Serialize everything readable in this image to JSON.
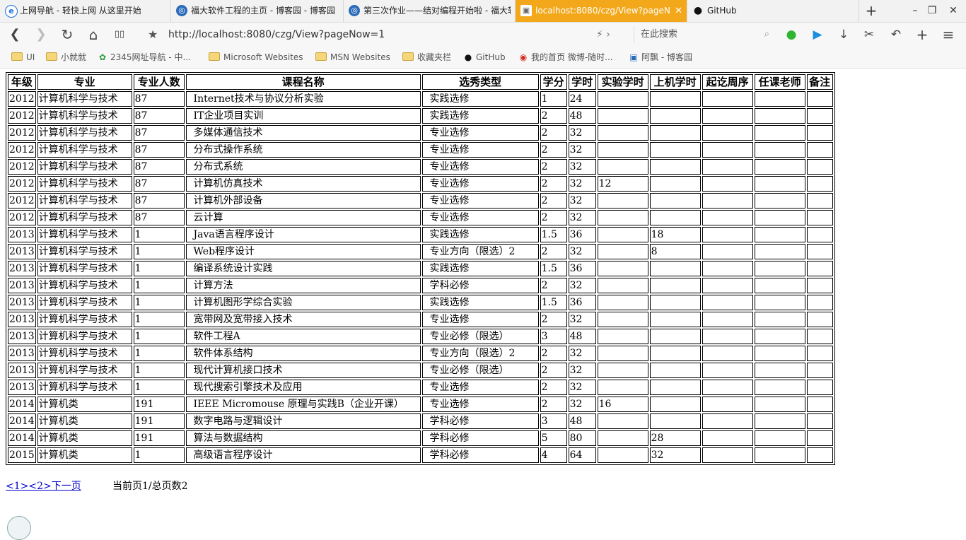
{
  "tabs": [
    {
      "label": "上网导航 - 轻快上网 从这里开始",
      "icon": "e"
    },
    {
      "label": "福大软件工程的主页 - 博客园 - 博客园",
      "icon": "◎"
    },
    {
      "label": "第三次作业——结对编程开始啦 - 福大软件工程",
      "icon": "◎"
    },
    {
      "label": "localhost:8080/czg/View?pageN",
      "icon": "▣",
      "close": "✕"
    },
    {
      "label": "GitHub",
      "icon": "●"
    }
  ],
  "window_controls": [
    "+",
    "–",
    "❐",
    "✕"
  ],
  "nav": {
    "back": "❮",
    "forward": "❯",
    "reload": "↻",
    "home": "⌂",
    "reader": "▯▯",
    "star": "★",
    "url": "http://localhost:8080/czg/View?pageNow=1",
    "lightning": "⚡ ›",
    "search_placeholder": "在此搜索",
    "search_icon": "⌕",
    "tools": [
      "●",
      "▶",
      "↓",
      "✂",
      "↶",
      "+",
      "≡"
    ]
  },
  "bookmarks": [
    {
      "label": "UI",
      "type": "folder"
    },
    {
      "label": "小就就",
      "type": "folder"
    },
    {
      "label": "2345网址导航 - 中...",
      "type": "site",
      "icon": "✿"
    },
    {
      "label": "Microsoft Websites",
      "type": "folder"
    },
    {
      "label": "MSN Websites",
      "type": "folder"
    },
    {
      "label": "收藏夹栏",
      "type": "folder"
    },
    {
      "label": "GitHub",
      "type": "site",
      "icon": "●"
    },
    {
      "label": "我的首页 微博-随时...",
      "type": "site",
      "icon": "◉"
    },
    {
      "label": "阿飘 - 博客园",
      "type": "site",
      "icon": "▣"
    }
  ],
  "table": {
    "headers": [
      "年级",
      "专业",
      "专业人数",
      "课程名称",
      "选秀类型",
      "学分",
      "学时",
      "实验学时",
      "上机学时",
      "起讫周序",
      "任课老师",
      "备注"
    ],
    "rows": [
      [
        "2012",
        "计算机科学与技术",
        "87",
        "  Internet技术与协议分析实验",
        "  实践选修",
        "1",
        "24",
        "",
        "",
        "",
        "",
        ""
      ],
      [
        "2012",
        "计算机科学与技术",
        "87",
        "  IT企业项目实训",
        "  实践选修",
        "2",
        "48",
        "",
        "",
        "",
        "",
        ""
      ],
      [
        "2012",
        "计算机科学与技术",
        "87",
        "  多媒体通信技术",
        "  专业选修",
        "2",
        "32",
        "",
        "",
        "",
        "",
        ""
      ],
      [
        "2012",
        "计算机科学与技术",
        "87",
        "  分布式操作系统",
        "  专业选修",
        "2",
        "32",
        "",
        "",
        "",
        "",
        ""
      ],
      [
        "2012",
        "计算机科学与技术",
        "87",
        "  分布式系统",
        "  专业选修",
        "2",
        "32",
        "",
        "",
        "",
        "",
        ""
      ],
      [
        "2012",
        "计算机科学与技术",
        "87",
        "  计算机仿真技术",
        "  专业选修",
        "2",
        "32",
        "12",
        "",
        "",
        "",
        ""
      ],
      [
        "2012",
        "计算机科学与技术",
        "87",
        "  计算机外部设备",
        "  专业选修",
        "2",
        "32",
        "",
        "",
        "",
        "",
        ""
      ],
      [
        "2012",
        "计算机科学与技术",
        "87",
        "  云计算",
        "  专业选修",
        "2",
        "32",
        "",
        "",
        "",
        "",
        ""
      ],
      [
        "2013",
        "计算机科学与技术",
        "1",
        "  Java语言程序设计",
        "  实践选修",
        "1.5",
        "36",
        "",
        "18",
        "",
        "",
        ""
      ],
      [
        "2013",
        "计算机科学与技术",
        "1",
        "  Web程序设计",
        "  专业方向（限选）2",
        "2",
        "32",
        "",
        "8",
        "",
        "",
        ""
      ],
      [
        "2013",
        "计算机科学与技术",
        "1",
        "  编译系统设计实践",
        "  实践选修",
        "1.5",
        "36",
        "",
        "",
        "",
        "",
        ""
      ],
      [
        "2013",
        "计算机科学与技术",
        "1",
        "  计算方法",
        "  学科必修",
        "2",
        "32",
        "",
        "",
        "",
        "",
        ""
      ],
      [
        "2013",
        "计算机科学与技术",
        "1",
        "  计算机图形学综合实验",
        "  实践选修",
        "1.5",
        "36",
        "",
        "",
        "",
        "",
        ""
      ],
      [
        "2013",
        "计算机科学与技术",
        "1",
        "  宽带网及宽带接入技术",
        "  专业选修",
        "2",
        "32",
        "",
        "",
        "",
        "",
        ""
      ],
      [
        "2013",
        "计算机科学与技术",
        "1",
        "  软件工程A",
        "  专业必修（限选）",
        "3",
        "48",
        "",
        "",
        "",
        "",
        ""
      ],
      [
        "2013",
        "计算机科学与技术",
        "1",
        "  软件体系结构",
        "  专业方向（限选）2",
        "2",
        "32",
        "",
        "",
        "",
        "",
        ""
      ],
      [
        "2013",
        "计算机科学与技术",
        "1",
        "  现代计算机接口技术",
        "  专业必修（限选）",
        "2",
        "32",
        "",
        "",
        "",
        "",
        ""
      ],
      [
        "2013",
        "计算机科学与技术",
        "1",
        "  现代搜索引擎技术及应用",
        "  专业选修",
        "2",
        "32",
        "",
        "",
        "",
        "",
        ""
      ],
      [
        "2014",
        "计算机类",
        "191",
        "  IEEE Micromouse 原理与实践B（企业开课）",
        "  专业选修",
        "2",
        "32",
        "16",
        "",
        "",
        "",
        ""
      ],
      [
        "2014",
        "计算机类",
        "191",
        "  数字电路与逻辑设计",
        "  学科必修",
        "3",
        "48",
        "",
        "",
        "",
        "",
        ""
      ],
      [
        "2014",
        "计算机类",
        "191",
        "  算法与数据结构",
        "  学科必修",
        "5",
        "80",
        "",
        "28",
        "",
        "",
        ""
      ],
      [
        "2015",
        "计算机类",
        "1",
        "  高级语言程序设计",
        "  学科必修",
        "4",
        "64",
        "",
        "32",
        "",
        "",
        ""
      ]
    ]
  },
  "pager": {
    "links": [
      "<1>",
      "<2>",
      "下一页"
    ],
    "info": "当前页1/总页数2"
  },
  "colors": {
    "active_tab": "#f3a81c",
    "link": "#0000cc",
    "wechat_green": "#2fb52f",
    "play_blue": "#1a8fe0"
  }
}
